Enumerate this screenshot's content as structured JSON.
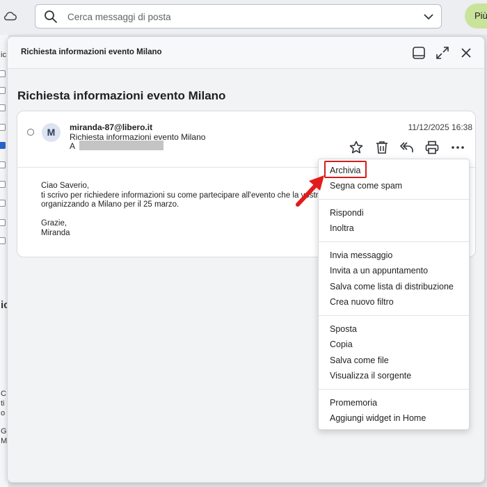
{
  "search": {
    "placeholder": "Cerca messaggi di posta"
  },
  "topbar": {
    "more_label": "Più"
  },
  "background": {
    "fragments": [
      "ic",
      "C",
      "ti",
      "o",
      "G",
      "M"
    ]
  },
  "modal": {
    "header_title": "Richiesta informazioni evento Milano",
    "subject": "Richiesta informazioni evento Milano"
  },
  "message": {
    "avatar_initial": "M",
    "from": "miranda-87@libero.it",
    "subject": "Richiesta informazioni evento Milano",
    "to_label": "A",
    "date": "11/12/2025 16:38",
    "body": "Ciao Saverio,\nti scrivo per richiedere informazioni su come partecipare all'evento che la vostra...\norganizzando a Milano per il 25 marzo.\n\nGrazie,\nMiranda"
  },
  "menu": {
    "items": [
      "Archivia",
      "Segna come spam",
      "Rispondi",
      "Inoltra",
      "Invia messaggio",
      "Invita a un appuntamento",
      "Salva come lista di distribuzione",
      "Crea nuovo filtro",
      "Sposta",
      "Copia",
      "Salva come file",
      "Visualizza il sorgente",
      "Promemoria",
      "Aggiungi widget in Home"
    ]
  },
  "colors": {
    "highlight": "#d41c1c",
    "arrow": "#e31b1b",
    "more_button": "#c9e39b",
    "checkbox_selected": "#2a63c7"
  }
}
